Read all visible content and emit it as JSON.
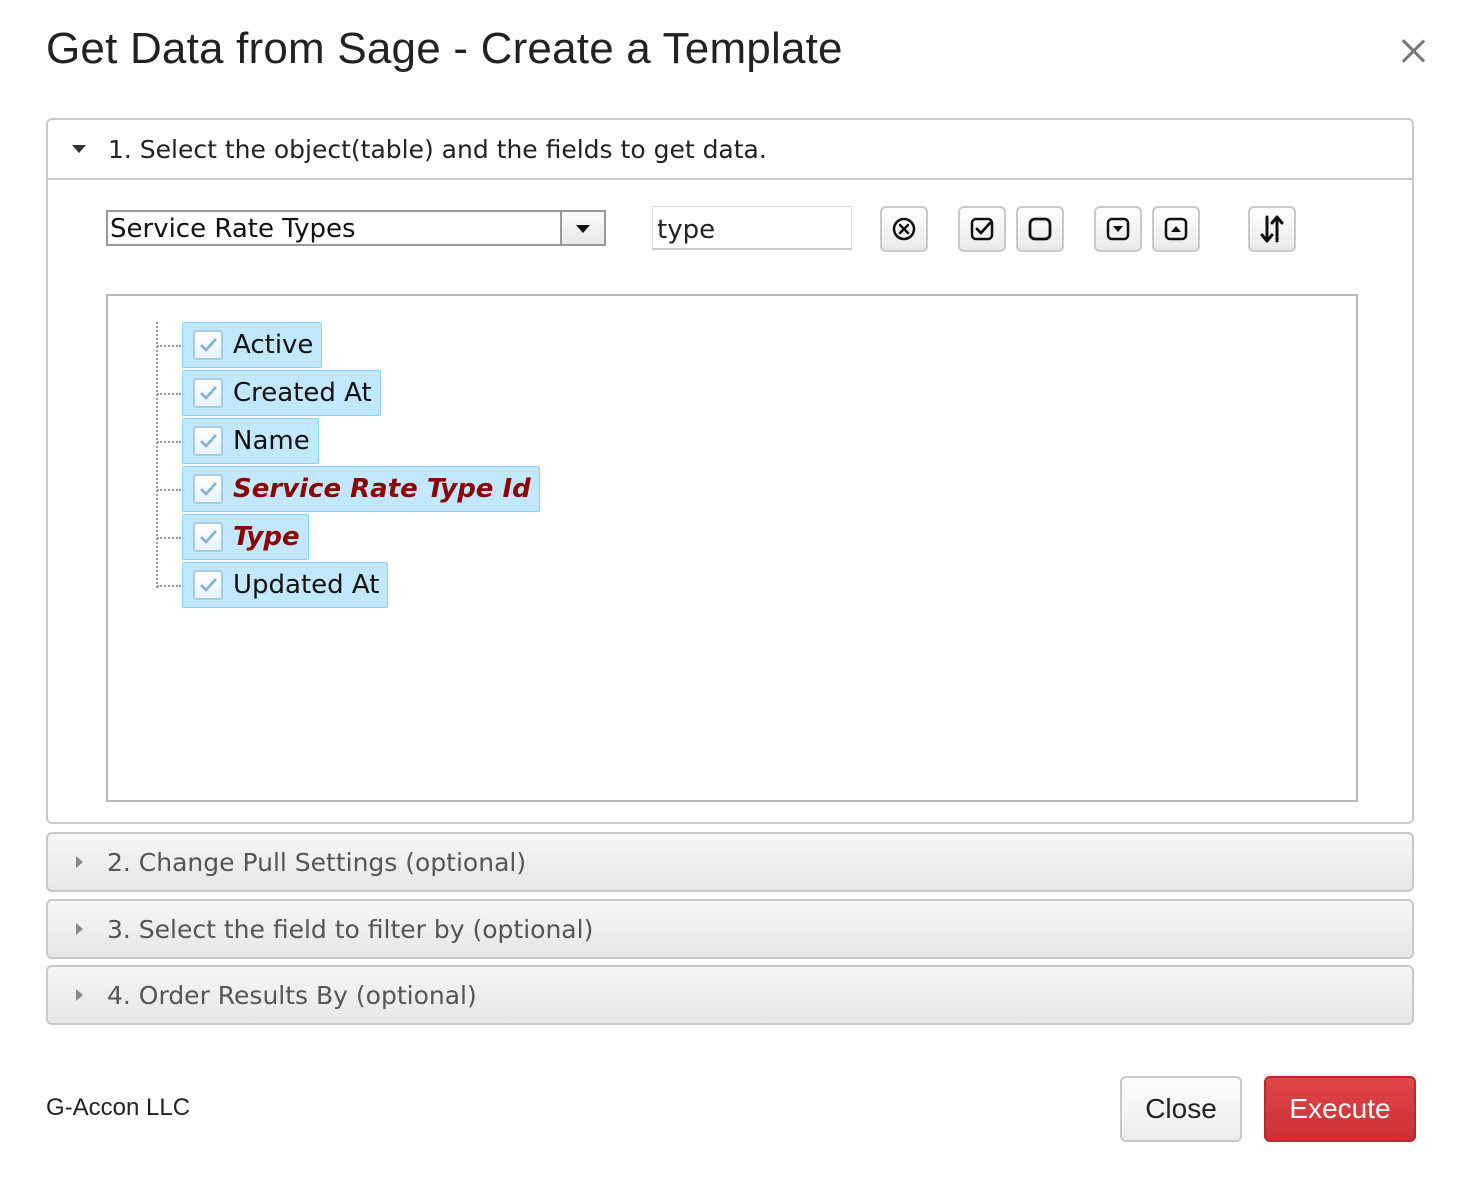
{
  "dialog": {
    "title": "Get Data from Sage - Create a Template"
  },
  "sections": {
    "s1": {
      "title": "1. Select the object(table) and the fields to get data.",
      "object_select": {
        "selected": "Service Rate Types"
      },
      "field_search": {
        "value": "type"
      },
      "fields": [
        {
          "label": "Active",
          "checked": true,
          "key": false
        },
        {
          "label": "Created At",
          "checked": true,
          "key": false
        },
        {
          "label": "Name",
          "checked": true,
          "key": false
        },
        {
          "label": "Service Rate Type Id",
          "checked": true,
          "key": true
        },
        {
          "label": "Type",
          "checked": true,
          "key": true
        },
        {
          "label": "Updated At",
          "checked": true,
          "key": false
        }
      ]
    },
    "s2": {
      "title": "2. Change Pull Settings (optional)"
    },
    "s3": {
      "title": "3. Select the field to filter by (optional)"
    },
    "s4": {
      "title": "4. Order Results By (optional)"
    }
  },
  "footer": {
    "brand": "G-Accon LLC",
    "close_label": "Close",
    "execute_label": "Execute"
  },
  "colors": {
    "execute": "#d23a3e",
    "key_field": "#8b0000",
    "node_highlight": "#c2e8ff"
  },
  "icons": {
    "toolbar": [
      "clear-search-icon",
      "check-all-icon",
      "uncheck-all-icon",
      "expand-icon",
      "collapse-icon",
      "sort-icon"
    ]
  }
}
